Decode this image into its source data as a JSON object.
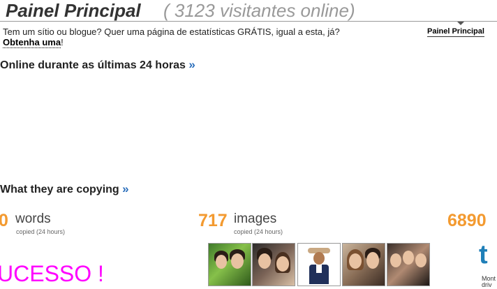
{
  "header": {
    "title": "Painel Principal",
    "visitors_text": "( 3123   visitantes online)",
    "nav_tab": "Painel Principal"
  },
  "promo": {
    "text": "Tem um sítio ou blogue? Quer uma página de estatísticas GRÁTIS, igual a esta, já?",
    "link_label": "Obtenha uma",
    "link_suffix": "!"
  },
  "online_section": {
    "heading": "Online durante as últimas 24 horas",
    "arrow": "»"
  },
  "copy_section": {
    "heading": "What they are copying",
    "arrow": "»"
  },
  "stats": {
    "words": {
      "number": "0",
      "label": "words",
      "sub": "copied (24 hours)"
    },
    "images": {
      "number": "717",
      "label": "images",
      "sub": "copied (24 hours)"
    },
    "third": {
      "number": "6890"
    }
  },
  "thumbnails": [
    {
      "name": "couple-photo-1"
    },
    {
      "name": "couple-photo-2"
    },
    {
      "name": "man-with-hat-photo"
    },
    {
      "name": "couple-photo-3"
    },
    {
      "name": "group-photo"
    }
  ],
  "banner_text": "UCESSO !",
  "logo": {
    "letter": "t",
    "caption_line1": "Mont",
    "caption_line2": "driv"
  },
  "colors": {
    "accent": "#f39a30",
    "link": "#2a6ebb",
    "banner": "#ff00ff",
    "logo": "#1f7fb8"
  }
}
